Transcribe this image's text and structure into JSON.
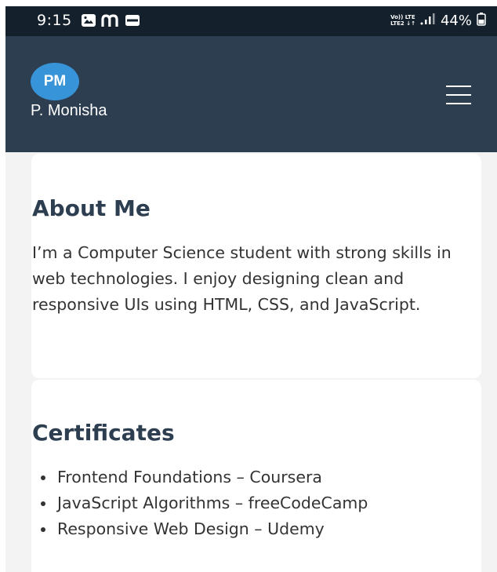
{
  "status_bar": {
    "time": "9:15",
    "net_top": "Vo)) LTE",
    "net_bottom": "LTE2 ↓↑",
    "battery": "44%",
    "icons": [
      "gallery-icon",
      "m-app-icon",
      "paytm-icon",
      "volte-icon",
      "signal-icon",
      "battery-icon"
    ]
  },
  "header": {
    "avatar_initials": "PM",
    "name": "P. Monisha",
    "menu_icon": "hamburger-menu-icon"
  },
  "about": {
    "title": "About Me",
    "text": "I’m a Computer Science student with strong skills in web technologies. I enjoy designing clean and responsive UIs using HTML, CSS, and JavaScript."
  },
  "certificates": {
    "title": "Certificates",
    "items": [
      "Frontend Foundations – Coursera",
      "JavaScript Algorithms – freeCodeCamp",
      "Responsive Web Design – Udemy"
    ]
  },
  "colors": {
    "status_bar": "#14202c",
    "header": "#2d3e50",
    "avatar": "#3794d8",
    "heading": "#2c3e50",
    "page_bg": "#f3f3f3"
  }
}
